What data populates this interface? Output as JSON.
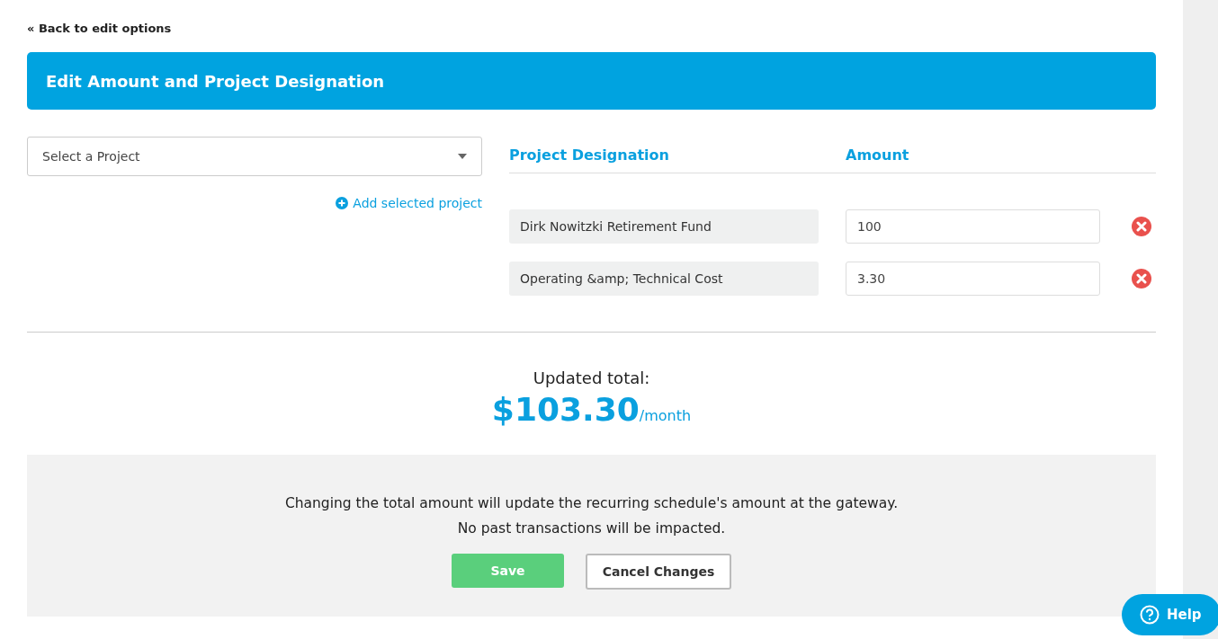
{
  "back_link": "« Back to edit options",
  "header": {
    "title": "Edit Amount and Project Designation"
  },
  "project_select": {
    "placeholder": "Select a Project"
  },
  "add_link": "Add selected project",
  "columns": [
    "Project Designation",
    "Amount"
  ],
  "designations": [
    {
      "project": "Dirk Nowitzki Retirement Fund",
      "amount": "100"
    },
    {
      "project": "Operating &amp; Technical Cost",
      "amount": "3.30"
    }
  ],
  "total": {
    "label": "Updated total:",
    "amount": "$103.30",
    "period": "/month"
  },
  "notice": [
    "Changing the total amount will update the recurring schedule's amount at the gateway.",
    "No past transactions will be impacted."
  ],
  "buttons": {
    "save": "Save",
    "cancel": "Cancel Changes"
  },
  "help": "Help"
}
